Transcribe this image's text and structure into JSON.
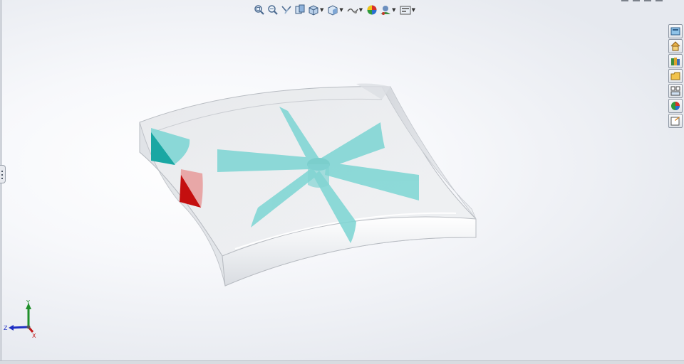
{
  "viewport": {
    "background_colors": [
      "#ffffff",
      "#e6e9ef"
    ]
  },
  "heads_up_toolbar": {
    "items": [
      {
        "icon": "zoom-to-fit-icon",
        "dropdown": false
      },
      {
        "icon": "zoom-to-area-icon",
        "dropdown": false
      },
      {
        "icon": "previous-view-icon",
        "dropdown": false
      },
      {
        "icon": "section-view-icon",
        "dropdown": false
      },
      {
        "icon": "view-orientation-icon",
        "dropdown": true
      },
      {
        "icon": "display-style-icon",
        "dropdown": true
      },
      {
        "icon": "hide-show-items-icon",
        "dropdown": true
      },
      {
        "icon": "edit-appearance-icon",
        "dropdown": false
      },
      {
        "icon": "apply-scene-icon",
        "dropdown": true
      },
      {
        "icon": "view-settings-icon",
        "dropdown": true
      }
    ]
  },
  "task_pane": {
    "items": [
      {
        "icon": "solidworks-resources-icon"
      },
      {
        "icon": "home-icon"
      },
      {
        "icon": "design-library-icon"
      },
      {
        "icon": "file-explorer-icon"
      },
      {
        "icon": "view-palette-icon"
      },
      {
        "icon": "appearances-scenes-icon"
      },
      {
        "icon": "custom-properties-icon"
      }
    ]
  },
  "model": {
    "enclosure_color": "#e9eaec",
    "impeller_color": "#7fd6d4",
    "inlet_color": "#1aa7a3",
    "outlet_color": "#c40f0f"
  },
  "triad": {
    "y_label": "Y",
    "z_label": "Z",
    "x_label": "X",
    "y_color": "#1f8f2a",
    "z_color": "#1f2fc4",
    "x_color": "#c21818"
  }
}
